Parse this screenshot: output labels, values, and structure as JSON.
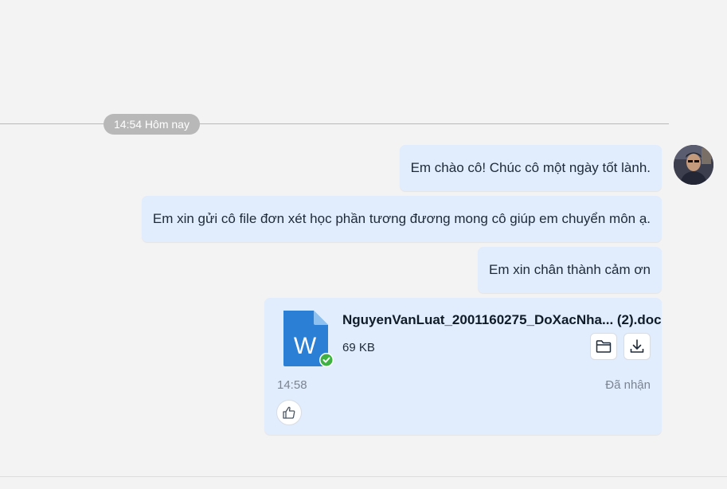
{
  "divider": {
    "time_label": "14:54 Hôm nay"
  },
  "messages": [
    {
      "text": "Em chào cô!  Chúc cô một ngày tốt lành."
    },
    {
      "text": "Em xin gửi cô file đơn xét học phần tương đương mong cô giúp em chuyển môn ạ."
    },
    {
      "text": "Em xin chân thành cảm ơn"
    }
  ],
  "file_message": {
    "file_name": "NguyenVanLuat_2001160275_DoXacNha... (2).doc",
    "file_size": "69 KB",
    "doc_icon_letter": "W",
    "time": "14:58",
    "status": "Đã nhận",
    "icons": [
      "word-file-icon",
      "check-badge-icon",
      "folder-icon",
      "download-icon",
      "thumbs-up-icon"
    ]
  },
  "colors": {
    "bubble": "#e1ecfd",
    "background": "#f3f3f3",
    "time_pill": "#b8b8b8",
    "word_blue": "#2b7fd4",
    "check_green": "#3fb042"
  }
}
